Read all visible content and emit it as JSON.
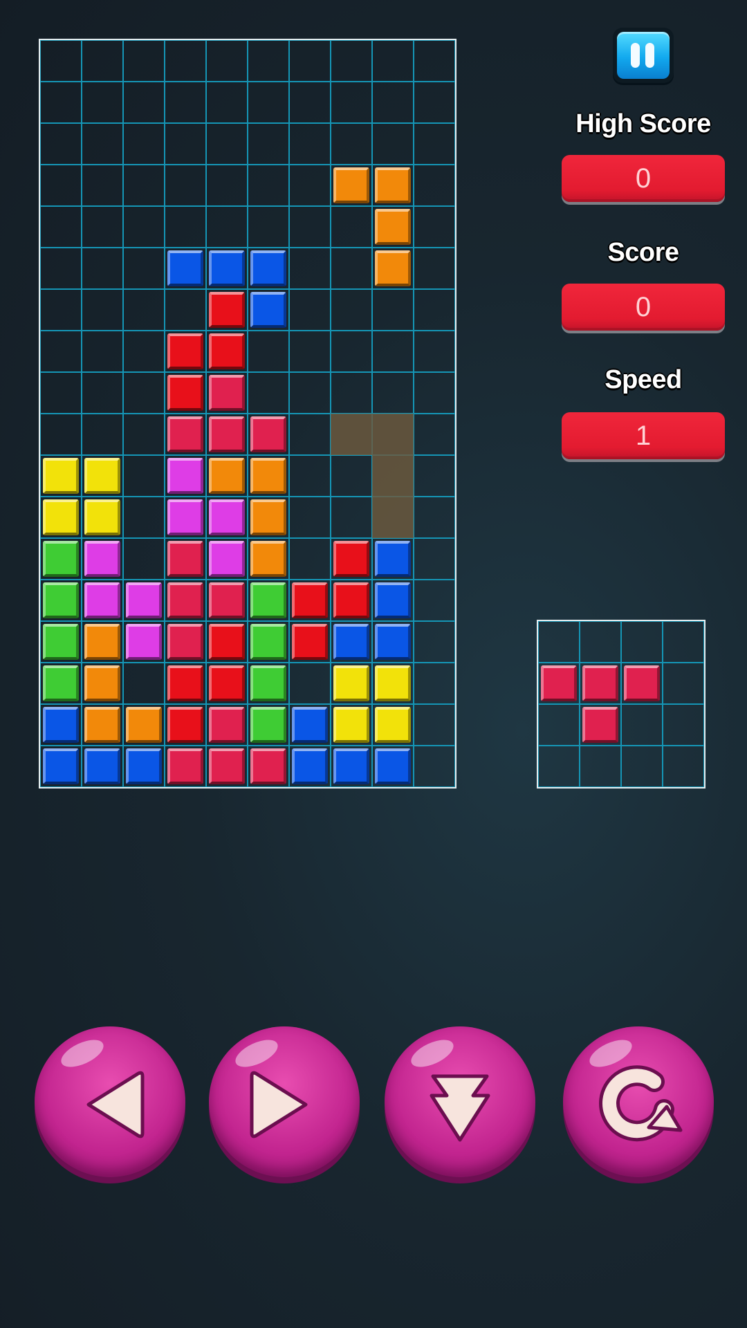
{
  "colors": {
    "yellow": "#f2e20a",
    "green": "#3fcc34",
    "blue": "#0a56e6",
    "red": "#e8101a",
    "crimson": "#e0214f",
    "magenta": "#de3de6",
    "orange": "#f2890a",
    "ghost": "#6e5a3e"
  },
  "board": {
    "cols": 10,
    "rows": 18,
    "blocks": [
      {
        "c": 7,
        "r": 3,
        "color": "orange"
      },
      {
        "c": 8,
        "r": 3,
        "color": "orange"
      },
      {
        "c": 8,
        "r": 4,
        "color": "orange"
      },
      {
        "c": 8,
        "r": 5,
        "color": "orange"
      },
      {
        "c": 3,
        "r": 5,
        "color": "blue"
      },
      {
        "c": 4,
        "r": 5,
        "color": "blue"
      },
      {
        "c": 5,
        "r": 5,
        "color": "blue"
      },
      {
        "c": 4,
        "r": 6,
        "color": "red"
      },
      {
        "c": 5,
        "r": 6,
        "color": "blue"
      },
      {
        "c": 3,
        "r": 7,
        "color": "red"
      },
      {
        "c": 4,
        "r": 7,
        "color": "red"
      },
      {
        "c": 3,
        "r": 8,
        "color": "red"
      },
      {
        "c": 4,
        "r": 8,
        "color": "crimson"
      },
      {
        "c": 3,
        "r": 9,
        "color": "crimson"
      },
      {
        "c": 4,
        "r": 9,
        "color": "crimson"
      },
      {
        "c": 5,
        "r": 9,
        "color": "crimson"
      },
      {
        "c": 0,
        "r": 10,
        "color": "yellow"
      },
      {
        "c": 1,
        "r": 10,
        "color": "yellow"
      },
      {
        "c": 3,
        "r": 10,
        "color": "magenta"
      },
      {
        "c": 4,
        "r": 10,
        "color": "orange"
      },
      {
        "c": 5,
        "r": 10,
        "color": "orange"
      },
      {
        "c": 0,
        "r": 11,
        "color": "yellow"
      },
      {
        "c": 1,
        "r": 11,
        "color": "yellow"
      },
      {
        "c": 3,
        "r": 11,
        "color": "magenta"
      },
      {
        "c": 4,
        "r": 11,
        "color": "magenta"
      },
      {
        "c": 5,
        "r": 11,
        "color": "orange"
      },
      {
        "c": 0,
        "r": 12,
        "color": "green"
      },
      {
        "c": 1,
        "r": 12,
        "color": "magenta"
      },
      {
        "c": 3,
        "r": 12,
        "color": "crimson"
      },
      {
        "c": 4,
        "r": 12,
        "color": "magenta"
      },
      {
        "c": 5,
        "r": 12,
        "color": "orange"
      },
      {
        "c": 7,
        "r": 12,
        "color": "red"
      },
      {
        "c": 8,
        "r": 12,
        "color": "blue"
      },
      {
        "c": 0,
        "r": 13,
        "color": "green"
      },
      {
        "c": 1,
        "r": 13,
        "color": "magenta"
      },
      {
        "c": 2,
        "r": 13,
        "color": "magenta"
      },
      {
        "c": 3,
        "r": 13,
        "color": "crimson"
      },
      {
        "c": 4,
        "r": 13,
        "color": "crimson"
      },
      {
        "c": 5,
        "r": 13,
        "color": "green"
      },
      {
        "c": 6,
        "r": 13,
        "color": "red"
      },
      {
        "c": 7,
        "r": 13,
        "color": "red"
      },
      {
        "c": 8,
        "r": 13,
        "color": "blue"
      },
      {
        "c": 0,
        "r": 14,
        "color": "green"
      },
      {
        "c": 1,
        "r": 14,
        "color": "orange"
      },
      {
        "c": 2,
        "r": 14,
        "color": "magenta"
      },
      {
        "c": 3,
        "r": 14,
        "color": "crimson"
      },
      {
        "c": 4,
        "r": 14,
        "color": "red"
      },
      {
        "c": 5,
        "r": 14,
        "color": "green"
      },
      {
        "c": 6,
        "r": 14,
        "color": "red"
      },
      {
        "c": 7,
        "r": 14,
        "color": "blue"
      },
      {
        "c": 8,
        "r": 14,
        "color": "blue"
      },
      {
        "c": 0,
        "r": 15,
        "color": "green"
      },
      {
        "c": 1,
        "r": 15,
        "color": "orange"
      },
      {
        "c": 3,
        "r": 15,
        "color": "red"
      },
      {
        "c": 4,
        "r": 15,
        "color": "red"
      },
      {
        "c": 5,
        "r": 15,
        "color": "green"
      },
      {
        "c": 7,
        "r": 15,
        "color": "yellow"
      },
      {
        "c": 8,
        "r": 15,
        "color": "yellow"
      },
      {
        "c": 0,
        "r": 16,
        "color": "blue"
      },
      {
        "c": 1,
        "r": 16,
        "color": "orange"
      },
      {
        "c": 2,
        "r": 16,
        "color": "orange"
      },
      {
        "c": 3,
        "r": 16,
        "color": "red"
      },
      {
        "c": 4,
        "r": 16,
        "color": "crimson"
      },
      {
        "c": 5,
        "r": 16,
        "color": "green"
      },
      {
        "c": 6,
        "r": 16,
        "color": "blue"
      },
      {
        "c": 7,
        "r": 16,
        "color": "yellow"
      },
      {
        "c": 8,
        "r": 16,
        "color": "yellow"
      },
      {
        "c": 0,
        "r": 17,
        "color": "blue"
      },
      {
        "c": 1,
        "r": 17,
        "color": "blue"
      },
      {
        "c": 2,
        "r": 17,
        "color": "blue"
      },
      {
        "c": 3,
        "r": 17,
        "color": "crimson"
      },
      {
        "c": 4,
        "r": 17,
        "color": "crimson"
      },
      {
        "c": 5,
        "r": 17,
        "color": "crimson"
      },
      {
        "c": 6,
        "r": 17,
        "color": "blue"
      },
      {
        "c": 7,
        "r": 17,
        "color": "blue"
      },
      {
        "c": 8,
        "r": 17,
        "color": "blue"
      }
    ],
    "ghost": [
      {
        "c": 7,
        "r": 9
      },
      {
        "c": 8,
        "r": 9
      },
      {
        "c": 8,
        "r": 10
      },
      {
        "c": 8,
        "r": 11
      }
    ]
  },
  "stats": {
    "high_score_label": "High Score",
    "high_score_value": "0",
    "score_label": "Score",
    "score_value": "0",
    "speed_label": "Speed",
    "speed_value": "1"
  },
  "next_piece": {
    "cols": 4,
    "rows": 4,
    "blocks": [
      {
        "c": 0,
        "r": 1,
        "color": "crimson"
      },
      {
        "c": 1,
        "r": 1,
        "color": "crimson"
      },
      {
        "c": 2,
        "r": 1,
        "color": "crimson"
      },
      {
        "c": 1,
        "r": 2,
        "color": "crimson"
      }
    ]
  },
  "controls": [
    {
      "name": "move-left-button",
      "icon": "arrow-left-icon"
    },
    {
      "name": "move-right-button",
      "icon": "arrow-right-icon"
    },
    {
      "name": "drop-down-button",
      "icon": "arrow-down-icon"
    },
    {
      "name": "rotate-button",
      "icon": "rotate-icon"
    }
  ]
}
